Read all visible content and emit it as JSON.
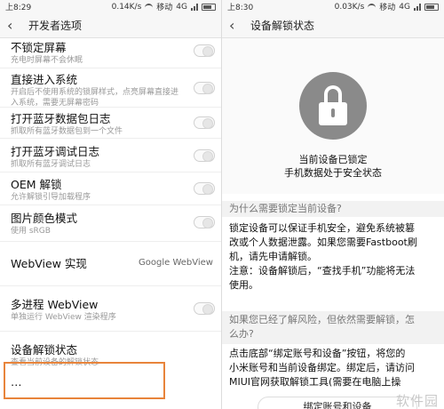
{
  "left": {
    "status": {
      "time": "上8:29",
      "speed": "0.14K/s",
      "carrier": "移动",
      "network": "4G"
    },
    "title": "开发者选项",
    "rows": [
      {
        "label": "不锁定屏幕",
        "sub": "充电时屏幕不会休眠",
        "control": "toggle"
      },
      {
        "label": "直接进入系统",
        "sub": "开启后不使用系统的锁屏样式，点亮屏幕直接进入系统，需要无屏幕密码",
        "control": "toggle"
      },
      {
        "label": "打开蓝牙数据包日志",
        "sub": "抓取所有蓝牙数据包到一个文件",
        "control": "toggle"
      },
      {
        "label": "打开蓝牙调试日志",
        "sub": "抓取所有蓝牙调试日志",
        "control": "toggle"
      },
      {
        "label": "OEM 解锁",
        "sub": "允许解锁引导加载程序",
        "control": "toggle"
      },
      {
        "label": "图片颜色模式",
        "sub": "使用 sRGB",
        "control": "toggle"
      },
      {
        "label": "WebView 实现",
        "sub": "",
        "control": "value",
        "value": "Google WebView"
      },
      {
        "label": "多进程 WebView",
        "sub": "单独运行 WebView 渲染程序",
        "control": "toggle"
      },
      {
        "label": "设备解锁状态",
        "sub": "查看当前设备的解锁状态",
        "control": "none"
      },
      {
        "label": "…",
        "sub": "",
        "control": "none"
      }
    ]
  },
  "right": {
    "status": {
      "time": "上8:30",
      "speed": "0.03K/s",
      "carrier": "移动",
      "network": "4G"
    },
    "title": "设备解锁状态",
    "lock_status_line1": "当前设备已锁定",
    "lock_status_line2": "手机数据处于安全状态",
    "q1": "为什么需要锁定当前设备?",
    "a1": [
      "锁定设备可以保证手机安全，避免系统被篡",
      "改或个人数据泄露。如果您需要Fastboot刷",
      "机，请先申请解锁。",
      "注意：设备解锁后，“查找手机”功能将无法",
      "使用。"
    ],
    "q2": [
      "如果您已经了解风险，但依然需要解锁，怎",
      "么办?"
    ],
    "a2": [
      "点击底部“绑定账号和设备”按钮，将您的",
      "小米账号和当前设备绑定。绑定后，请访问",
      "MIUI官网获取解锁工具(需要在电脑上操"
    ],
    "bind_button": "绑定账号和设备",
    "watermark": "软件园"
  },
  "colors": {
    "highlight": "#e8843b",
    "lock": "#8a8a8a"
  }
}
